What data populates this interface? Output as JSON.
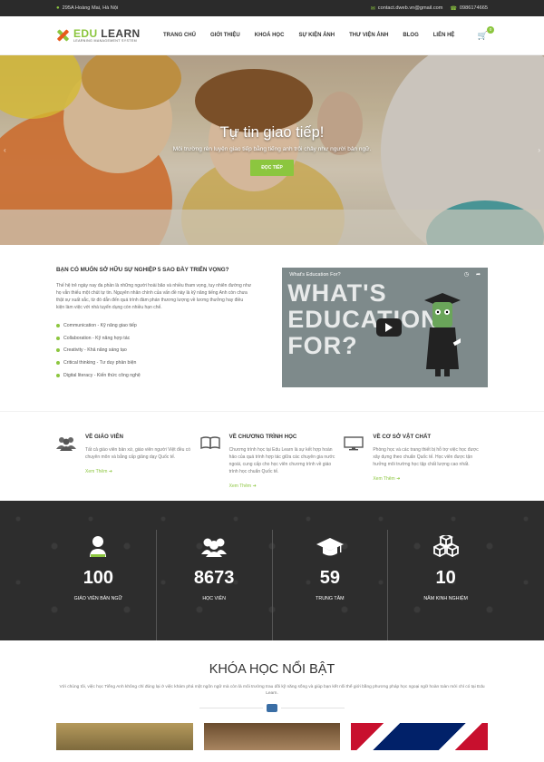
{
  "topbar": {
    "address": "295A Hoàng Mai, Hà Nội",
    "email": "contact.dweb.vn@gmail.com",
    "phone": "0986174665"
  },
  "brand": {
    "name_part1": "EDU ",
    "name_part2": "LEARN",
    "tagline": "LEARNING MANAGEMENT SYSTEM",
    "colors": {
      "accent": "#8cc63f",
      "accent2": "#e85a1d",
      "dark": "#2d2d2d"
    }
  },
  "nav": [
    "TRANG CHỦ",
    "GIỚI THIỆU",
    "KHOÁ HỌC",
    "SỰ KIỆN ẢNH",
    "THƯ VIỆN ẢNH",
    "BLOG",
    "LIÊN HỆ"
  ],
  "cart": {
    "count": "0"
  },
  "hero": {
    "title": "Tự tin giao tiếp!",
    "subtitle": "Môi trường rèn luyện giao tiếp bằng tiếng anh trôi chảy như người bản ngữ.",
    "button": "ĐỌC TIẾP"
  },
  "intro": {
    "heading": "BẠN CÓ MUỐN SỞ HỮU SỰ NGHIỆP 5 SAO ĐẦY TRIỂN VỌNG?",
    "description": "Thế hệ trẻ ngày nay đa phần là những người hoài bão và nhiều tham vọng, tuy nhiên đường như họ vẫn thiếu một chút tự tin. Nguyên nhân chính của vấn đề này là kỹ năng tiếng Anh còn chưa thật sự xuất sắc, từ đó dẫn đến quá trình đàm phán thương lượng về lương thưởng hay điều kiện làm việc với nhà tuyển dụng còn nhiều hạn chế.",
    "bullets": [
      "Communication - Kỹ năng giao tiếp",
      "Collaboration - Kỹ năng hợp tác",
      "Creativity - Khả năng sáng tạo",
      "Critical thinking - Tư duy phản biện",
      "Digital literacy - Kiến thức công nghệ"
    ],
    "video": {
      "title": "What's Education For?",
      "big_text": "WHAT'S EDUCATION FOR?"
    }
  },
  "features": [
    {
      "title": "VỀ GIÁO VIÊN",
      "text": "Tất cả giáo viên bản xứ, giáo viên người Việt đều có chuyên môn và bằng cấp giảng dạy Quốc tế.",
      "more": "Xem Thêm",
      "icon": "users-icon"
    },
    {
      "title": "VỀ CHƯƠNG TRÌNH HỌC",
      "text": "Chương trình học tại Edu Learn là sự kết hợp hoàn hảo của quá trình hợp tác giữa các chuyên gia nước ngoài, cung cấp cho học viên chương trình về giáo trình học chuẩn Quốc tế.",
      "more": "Xem Thêm",
      "icon": "book-icon"
    },
    {
      "title": "VỀ CƠ SỞ VẬT CHẤT",
      "text": "Phòng học và các trang thiết bị hỗ trợ việc học được xây dựng theo chuẩn Quốc tế. Học viên được tận hưởng môi trường học tập chất lượng cao nhất.",
      "more": "Xem Thêm",
      "icon": "monitor-icon"
    }
  ],
  "stats": [
    {
      "num": "100",
      "label": "GIÁO VIÊN BẢN NGỮ",
      "icon": "teacher-icon"
    },
    {
      "num": "8673",
      "label": "HỌC VIÊN",
      "icon": "group-icon"
    },
    {
      "num": "59",
      "label": "TRUNG TÂM",
      "icon": "graduation-cap-icon"
    },
    {
      "num": "10",
      "label": "NĂM KINH NGHIỆM",
      "icon": "boxes-icon"
    }
  ],
  "featured": {
    "title": "KHÓA HỌC NỔI BẬT",
    "text": "Với chúng tôi, việc học Tiếng Anh không chỉ đúng lại ở việc khám phá một ngôn ngữ mà còn là môi trường trau dồi kỹ năng sống và giúp bạn kết nối thế giới bằng phương pháp học ngoại ngữ hoàn toàn mới chỉ có tại Edu Learn."
  }
}
